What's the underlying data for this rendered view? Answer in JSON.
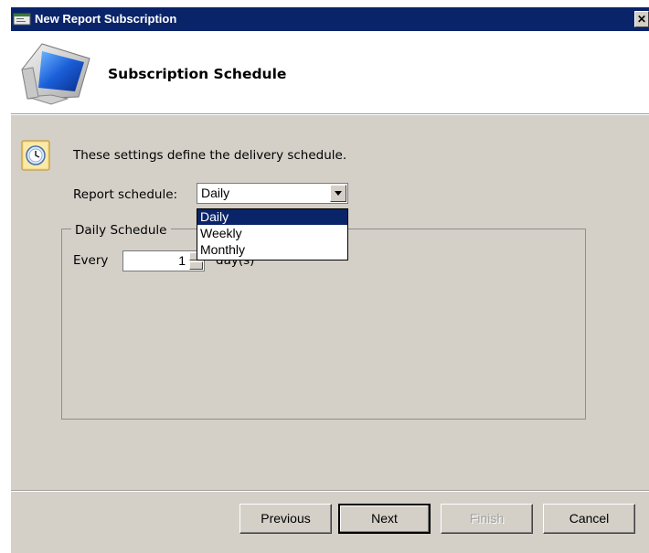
{
  "window": {
    "title": "New Report Subscription",
    "close_label": "✕"
  },
  "header": {
    "title": "Subscription Schedule"
  },
  "info": {
    "text": "These settings define the delivery schedule."
  },
  "schedule": {
    "label": "Report schedule:",
    "selected": "Daily",
    "options": [
      "Daily",
      "Weekly",
      "Monthly"
    ],
    "highlighted_index": 0
  },
  "daily": {
    "group_label": "Daily Schedule",
    "every_label": "Every",
    "every_value": "1",
    "unit_label": "day(s)"
  },
  "buttons": {
    "previous": "Previous",
    "next": "Next",
    "finish": "Finish",
    "cancel": "Cancel"
  },
  "colors": {
    "title_bar": "#0a246a",
    "dialog_bg": "#d4d0c8",
    "selection": "#0a246a"
  }
}
